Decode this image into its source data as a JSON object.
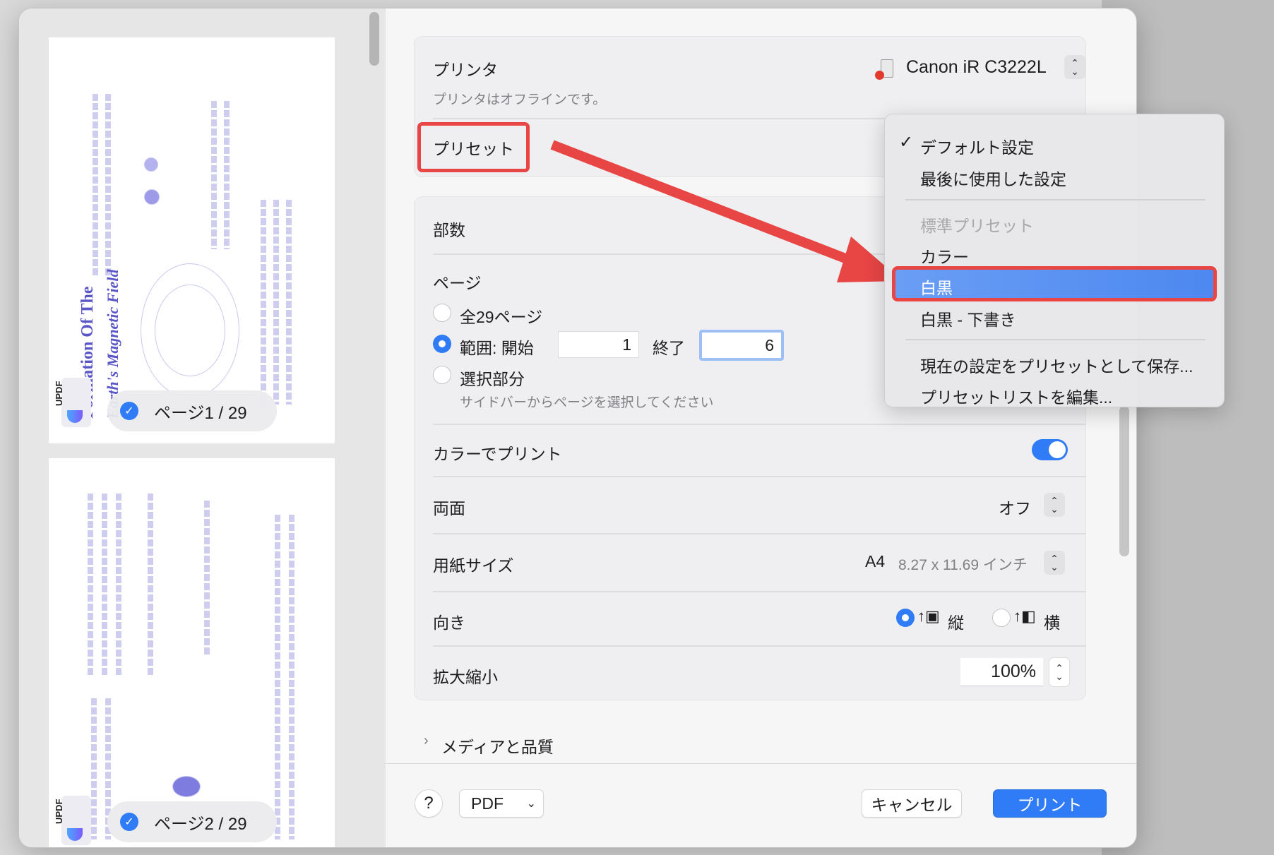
{
  "sidebar": {
    "pages": [
      {
        "label": "ページ1 / 29",
        "title_line1": "Formation Of The",
        "title_line2": "Earth's Magnetic Field",
        "logo": "UPDF"
      },
      {
        "label": "ページ2 / 29",
        "logo": "UPDF"
      }
    ]
  },
  "printer": {
    "label": "プリンタ",
    "name": "Canon iR C3222L",
    "status": "プリンタはオフラインです。"
  },
  "preset": {
    "label": "プリセット",
    "menu": {
      "items": [
        {
          "label": "デフォルト設定",
          "checked": true
        },
        {
          "label": "最後に使用した設定"
        },
        {
          "label": "標準プリセット",
          "disabled": true
        },
        {
          "label": "カラー"
        },
        {
          "label": "白黒",
          "highlighted": true
        },
        {
          "label": "白黒 - 下書き"
        },
        {
          "label": "現在の設定をプリセットとして保存..."
        },
        {
          "label": "プリセットリストを編集..."
        }
      ]
    }
  },
  "settings": {
    "copies_label": "部数",
    "pages_label": "ページ",
    "all_pages": "全29ページ",
    "range_label": "範囲: 開始",
    "range_start": "1",
    "range_end_label": "終了",
    "range_end": "6",
    "selection_label": "選択部分",
    "selection_hint": "サイドバーからページを選択してください",
    "color_print_label": "カラーでプリント",
    "color_print_on": true,
    "duplex_label": "両面",
    "duplex_value": "オフ",
    "paper_label": "用紙サイズ",
    "paper_value": "A4",
    "paper_dims": "8.27 x 11.69 インチ",
    "orientation_label": "向き",
    "portrait": "縦",
    "landscape": "横",
    "scale_label": "拡大縮小",
    "scale_value": "100%",
    "media_label": "メディアと品質"
  },
  "footer": {
    "help": "?",
    "pdf": "PDF",
    "cancel": "キャンセル",
    "print": "プリント"
  },
  "colors": {
    "accent": "#2f7cf6",
    "annotation": "#e84545"
  }
}
